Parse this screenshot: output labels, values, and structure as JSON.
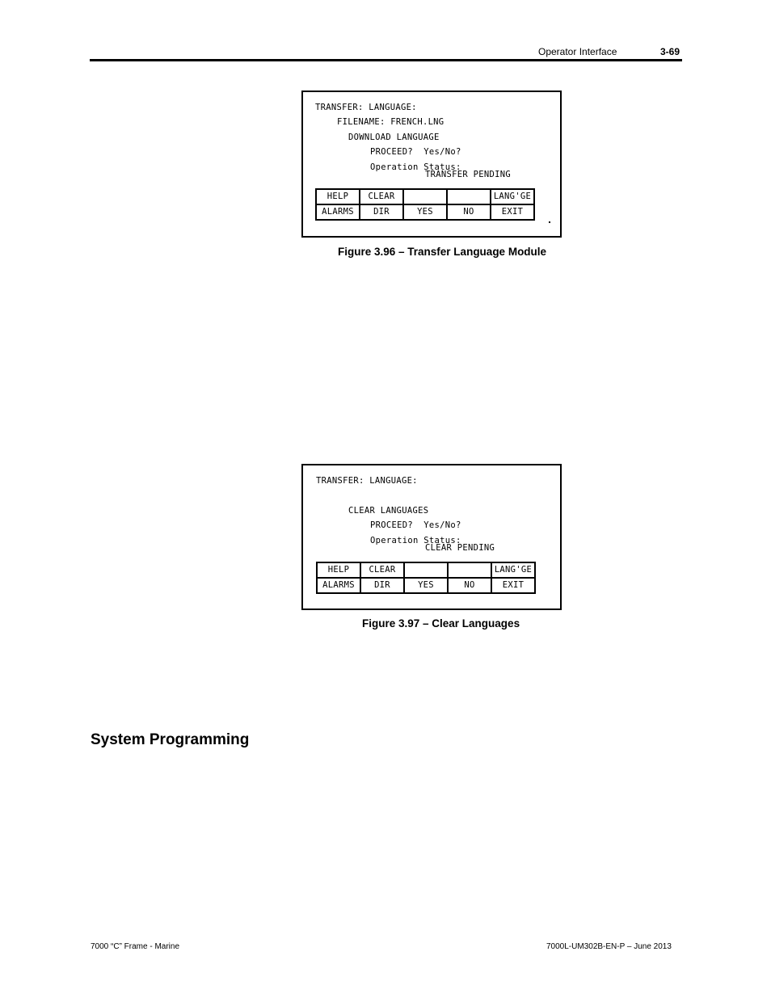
{
  "header": {
    "title": "Operator Interface",
    "page_number": "3-69"
  },
  "figure_96": {
    "lines": {
      "l1": "TRANSFER: LANGUAGE:",
      "l2": "FILENAME: FRENCH.LNG",
      "l3": "DOWNLOAD LANGUAGE",
      "l4": "PROCEED?  Yes/No?",
      "l5": "Operation Status:",
      "l6": "TRANSFER PENDING"
    },
    "keys_row1": [
      "HELP",
      "CLEAR",
      "",
      "",
      "LANG'GE"
    ],
    "keys_row2": [
      "ALARMS",
      "DIR",
      "YES",
      "NO",
      "EXIT"
    ],
    "caption": "Figure 3.96 – Transfer Language Module"
  },
  "figure_97": {
    "lines": {
      "l1": "TRANSFER: LANGUAGE:",
      "l3": "CLEAR LANGUAGES",
      "l4": "PROCEED?  Yes/No?",
      "l5": "Operation Status:",
      "l6": "CLEAR PENDING"
    },
    "keys_row1": [
      "HELP",
      "CLEAR",
      "",
      "",
      "LANG'GE"
    ],
    "keys_row2": [
      "ALARMS",
      "DIR",
      "YES",
      "NO",
      "EXIT"
    ],
    "caption": "Figure 3.97 – Clear Languages"
  },
  "section_heading": "System Programming",
  "footer": {
    "left": "7000 “C” Frame - Marine",
    "right": "7000L-UM302B-EN-P – June 2013"
  }
}
